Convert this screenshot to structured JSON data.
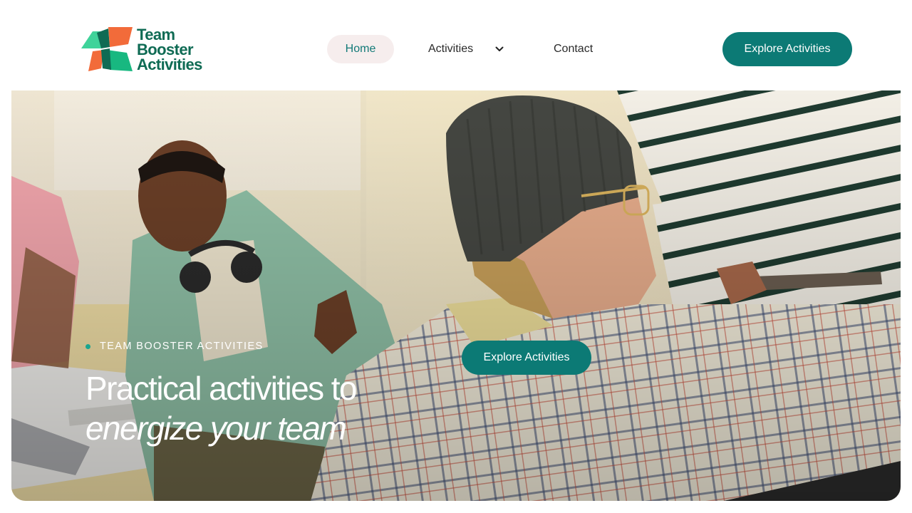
{
  "brand": {
    "logo_lines": [
      "Team",
      "Booster",
      "Activities"
    ],
    "colors": {
      "primary_teal": "#0c7a75",
      "logo_green": "#0f6b54",
      "accent_green": "#1aa58f",
      "accent_orange": "#f26b3a",
      "nav_active_bg": "#f6eded"
    }
  },
  "nav": {
    "items": [
      {
        "label": "Home",
        "active": true
      },
      {
        "label": "Activities",
        "icon": "chevron-down-icon"
      },
      {
        "label": "Contact"
      }
    ],
    "cta_label": "Explore Activities"
  },
  "hero": {
    "eyebrow": "TEAM BOOSTER ACTIVITIES",
    "title_line1": "Practical activities to",
    "title_line2": "energize your team",
    "cta_label": "Explore Activities",
    "image": "team-meeting-photo"
  }
}
